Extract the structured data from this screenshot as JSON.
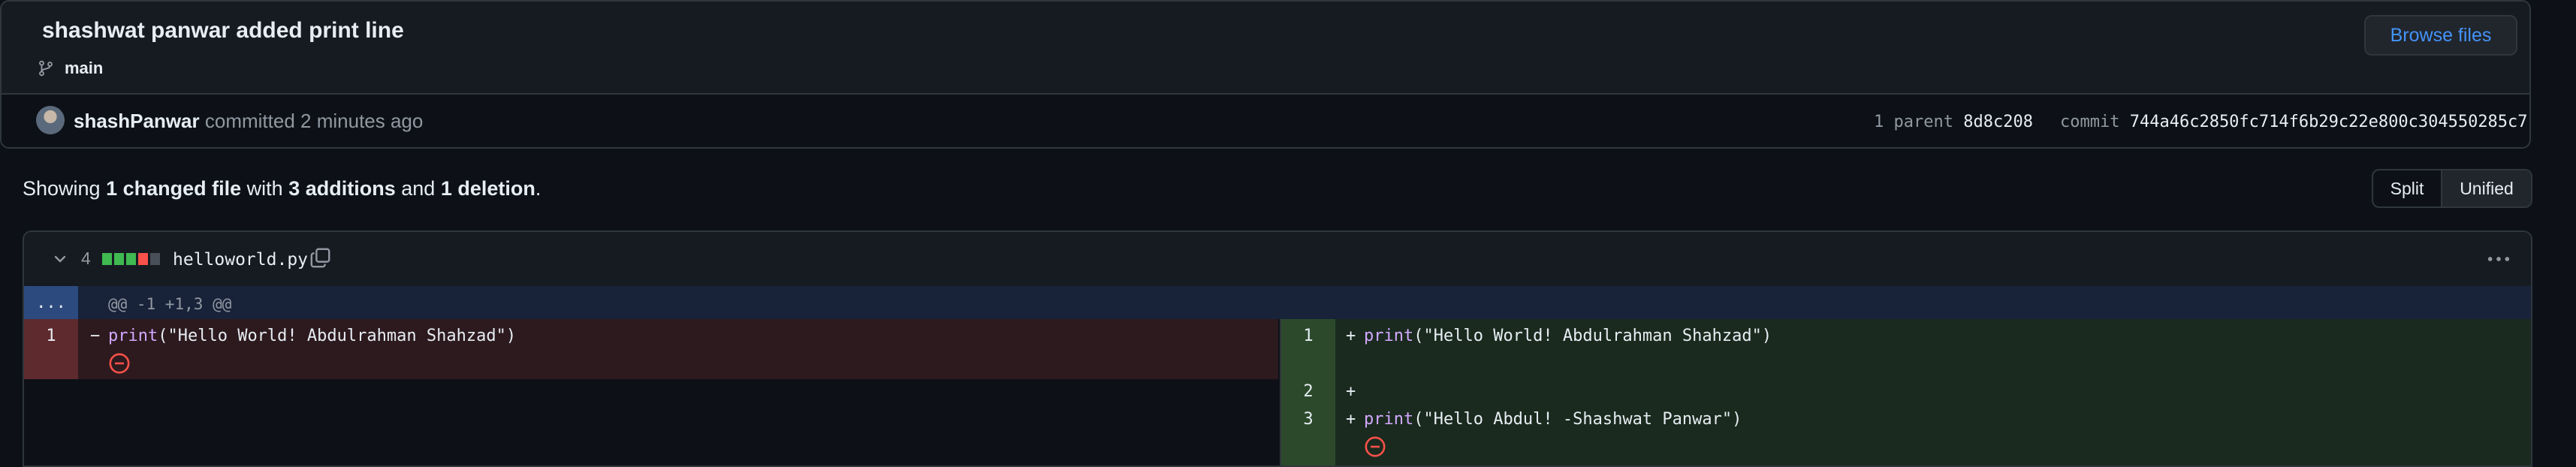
{
  "commit": {
    "title": "shashwat panwar added print line",
    "branch": "main",
    "browse_label": "Browse files",
    "author": "shashPanwar",
    "action": "committed",
    "time": "2 minutes ago",
    "parent_label": "1 parent",
    "parent_sha": "8d8c208",
    "commit_label": "commit",
    "commit_sha": "744a46c2850fc714f6b29c22e800c304550285c7"
  },
  "summary": {
    "showing": "Showing",
    "changed": "1 changed file",
    "with": "with",
    "additions": "3 additions",
    "and": "and",
    "deletions": "1 deletion",
    "period": "."
  },
  "view_toggle": {
    "split": "Split",
    "unified": "Unified",
    "selected": "Unified"
  },
  "file": {
    "change_count": "4",
    "name": "helloworld.py",
    "diffstat": [
      "add",
      "add",
      "add",
      "del",
      "neutral"
    ],
    "colors": {
      "add": "#3fb950",
      "del": "#f85149",
      "neutral": "#484f58"
    }
  },
  "diff": {
    "expand_label": "...",
    "hunk_header": "@@ -1 +1,3 @@",
    "left": [
      {
        "num": "1",
        "sign": "−",
        "fn": "print",
        "rest": "(\"Hello World! Abdulrahman Shahzad\")"
      }
    ],
    "right": [
      {
        "num": "1",
        "sign": "+",
        "fn": "print",
        "rest": "(\"Hello World! Abdulrahman Shahzad\")"
      },
      {
        "num": "2",
        "sign": "+",
        "fn": "",
        "rest": ""
      },
      {
        "num": "3",
        "sign": "+",
        "fn": "print",
        "rest": "(\"Hello Abdul! -Shashwat Panwar\")"
      }
    ]
  }
}
